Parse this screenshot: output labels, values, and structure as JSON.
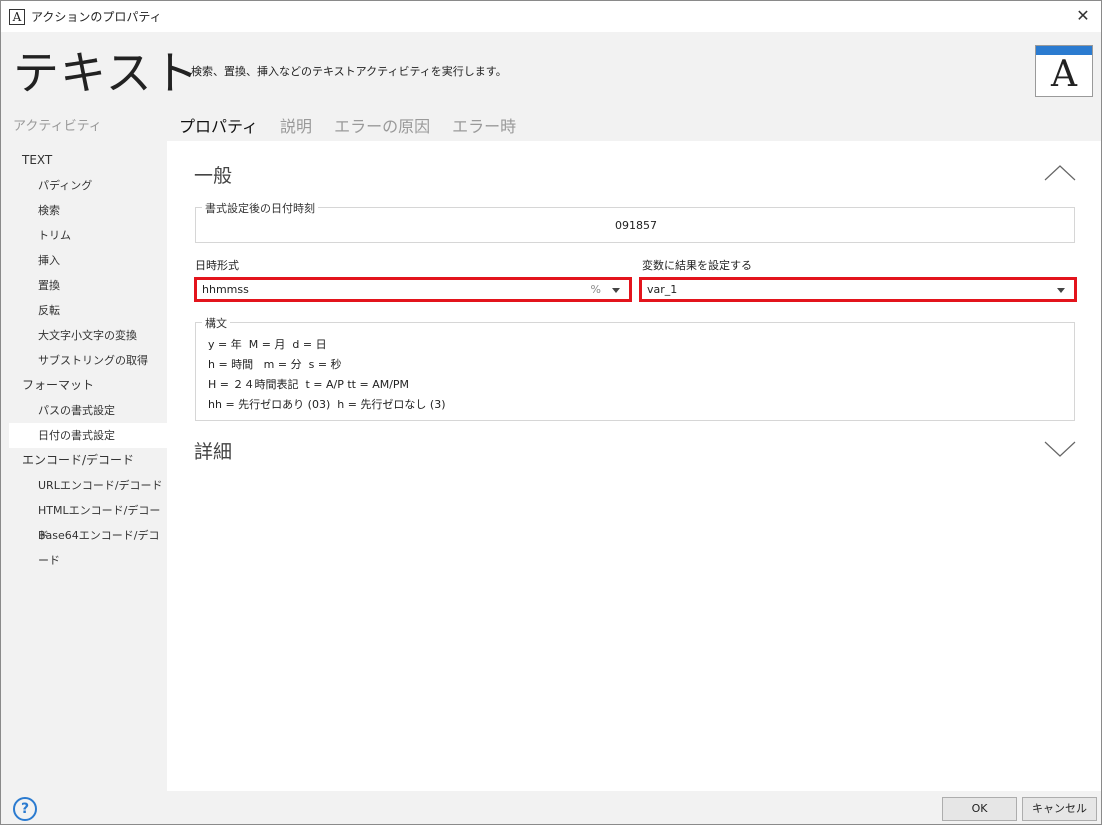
{
  "window": {
    "title": "アクションのプロパティ",
    "icon_letter": "A",
    "close_glyph": "✕"
  },
  "header": {
    "title": "テキスト",
    "description": "検索、置換、挿入などのテキストアクティビティを実行します。",
    "icon_letter": "A"
  },
  "sidebar": {
    "heading": "アクティビティ",
    "groups": [
      {
        "label": "TEXT",
        "items": [
          "パディング",
          "検索",
          "トリム",
          "挿入",
          "置換",
          "反転",
          "大文字小文字の変換",
          "サブストリングの取得"
        ]
      },
      {
        "label": "フォーマット",
        "items": [
          "パスの書式設定",
          "日付の書式設定"
        ]
      },
      {
        "label": "エンコード/デコード",
        "items": [
          "URLエンコード/デコード",
          "HTMLエンコード/デコード",
          "Base64エンコード/デコード"
        ]
      }
    ],
    "active_item": "日付の書式設定"
  },
  "tabs": [
    "プロパティ",
    "説明",
    "エラーの原因",
    "エラー時"
  ],
  "general": {
    "title": "一般",
    "formatted_datetime": {
      "label": "書式設定後の日付時刻",
      "value": "091857"
    },
    "datetime_format": {
      "label": "日時形式",
      "value": "hhmmss",
      "percent_glyph": "%"
    },
    "result_variable": {
      "label": "変数に結果を設定する",
      "value": "var_1"
    },
    "syntax": {
      "label": "構文",
      "lines": [
        "y = 年  M = 月  d = 日",
        "h = 時間   m = 分  s = 秒",
        "H = ２４時間表記  t = A/P tt = AM/PM",
        "hh = 先行ゼロあり (03)  h = 先行ゼロなし (3)"
      ]
    }
  },
  "details": {
    "title": "詳細"
  },
  "footer": {
    "help_glyph": "?",
    "ok_label": "OK",
    "cancel_label": "キャンセル"
  },
  "colors": {
    "highlight": "#e3141c",
    "accent": "#2b7bd0"
  }
}
